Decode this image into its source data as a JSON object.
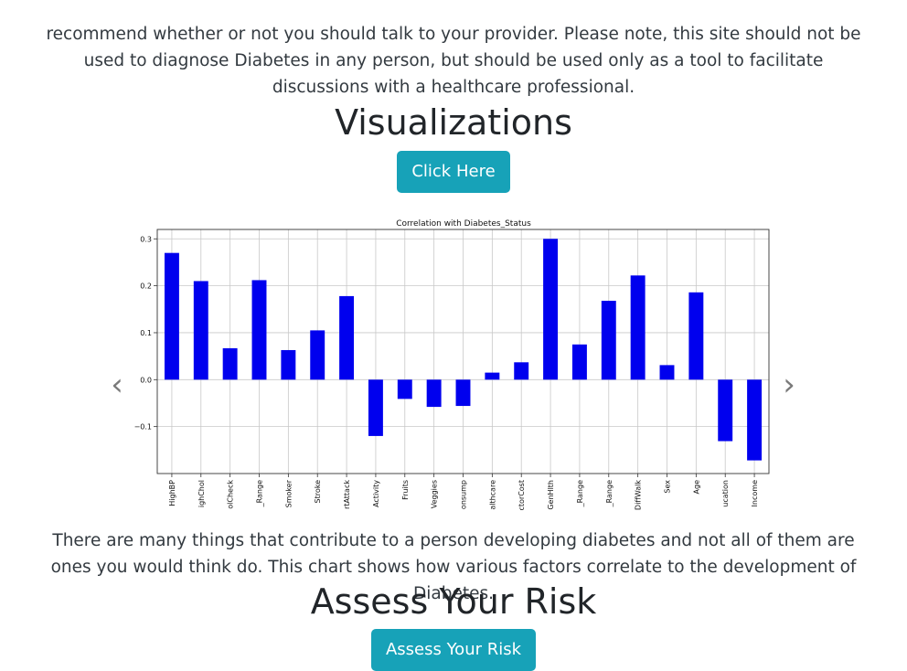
{
  "intro": {
    "text": "recommend whether or not you should talk to your provider. Please note, this site should not be used to diagnose Diabetes in any person, but should be used only as a tool to facilitate discussions with a healthcare professional."
  },
  "visualizations": {
    "heading": "Visualizations",
    "button_label": "Click Here"
  },
  "carousel": {
    "prev_icon": "chevron-left-icon",
    "next_icon": "chevron-right-icon",
    "prev_glyph": "‹",
    "next_glyph": "›"
  },
  "chart_data": {
    "type": "bar",
    "title": "Correlation with Diabetes_Status",
    "xlabel": "",
    "ylabel": "",
    "ylim": [
      -0.2,
      0.32
    ],
    "yticks": [
      0.3,
      0.2,
      0.1,
      0.0,
      -0.1
    ],
    "ytick_labels": [
      "0.3",
      "0.2",
      "0.1",
      "0.0",
      "−0.1"
    ],
    "grid": true,
    "bar_color": "#0000ee",
    "categories": [
      "HighBP",
      "ighChol",
      "olCheck",
      "_Range",
      "Smoker",
      "Stroke",
      "rtAttack",
      "Activity",
      "Fruits",
      "Veggies",
      "onsump",
      "althcare",
      "ctorCost",
      "GenHlth",
      "_Range",
      "_Range",
      "DiffWalk",
      "Sex",
      "Age",
      "ucation",
      "Income"
    ],
    "values": [
      0.27,
      0.21,
      0.067,
      0.212,
      0.063,
      0.105,
      0.178,
      -0.12,
      -0.041,
      -0.058,
      -0.056,
      0.015,
      0.037,
      0.3,
      0.075,
      0.168,
      0.222,
      0.031,
      0.186,
      -0.131,
      -0.172
    ]
  },
  "caption": {
    "text": "There are many things that contribute to a person developing diabetes and not all of them are ones you would think do. This chart shows how various factors correlate to the development of Diabetes."
  },
  "assess": {
    "heading": "Assess Your Risk",
    "button_label": "Assess Your Risk"
  }
}
